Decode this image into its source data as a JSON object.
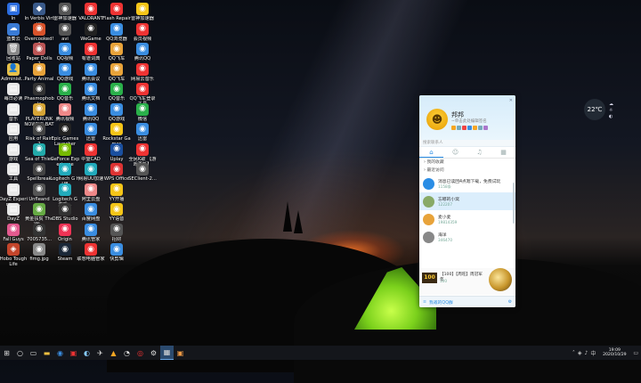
{
  "desktop_icons": [
    {
      "label": "In",
      "color": "#2b6de0",
      "glyph": "▣"
    },
    {
      "label": "蓝奏云",
      "color": "#3a7bd5",
      "glyph": "☁"
    },
    {
      "label": "回收站",
      "color": "#888",
      "glyph": "🗑"
    },
    {
      "label": "Administ...",
      "color": "#e6c14a",
      "glyph": "👤"
    },
    {
      "label": "每日必读",
      "color": "#e7e7e7",
      "glyph": "▤"
    },
    {
      "label": "音乐",
      "color": "#e7e7e7",
      "glyph": "▤"
    },
    {
      "label": "应用",
      "color": "#e7e7e7",
      "glyph": "▤"
    },
    {
      "label": "游戏",
      "color": "#e7e7e7",
      "glyph": "▤"
    },
    {
      "label": "工具",
      "color": "#e7e7e7",
      "glyph": "▤"
    },
    {
      "label": "DayZ Experimen...",
      "color": "#e7e7e7",
      "glyph": "▤"
    },
    {
      "label": "DayZ",
      "color": "#e7e7e7",
      "glyph": "▤"
    },
    {
      "label": "Fall Guys",
      "color": "#e35a8f",
      "glyph": "◉"
    },
    {
      "label": "Hobo Tough Life",
      "color": "#c4452b",
      "glyph": "◈"
    },
    {
      "label": "In Verbis Virtus",
      "color": "#3a5a8a",
      "glyph": "◆"
    },
    {
      "label": "Overcooked! 2",
      "color": "#d9532b",
      "glyph": "◉"
    },
    {
      "label": "Paper Dolls 2",
      "color": "#b55",
      "glyph": "◉"
    },
    {
      "label": "Party Animals",
      "color": "#e8a33a",
      "glyph": "◉"
    },
    {
      "label": "Phasmophobia",
      "color": "#333",
      "glyph": "◉"
    },
    {
      "label": "PLAYERUNKNOWN'S BATTLEGROUNDS",
      "color": "#d6a536",
      "glyph": "◉"
    },
    {
      "label": "Risk of Rain 2",
      "color": "#444",
      "glyph": "◉"
    },
    {
      "label": "Sea of Thieves",
      "color": "#2aa",
      "glyph": "◉"
    },
    {
      "label": "Spellbreak",
      "color": "#444",
      "glyph": "◉"
    },
    {
      "label": "Unfleand",
      "color": "#555",
      "glyph": "◉"
    },
    {
      "label": "黄金扶贫 The Wi...",
      "color": "#6a4",
      "glyph": "◉"
    },
    {
      "label": "7005735...",
      "color": "#333",
      "glyph": "◉"
    },
    {
      "label": "fimg.jpg",
      "color": "#888",
      "glyph": "◉"
    },
    {
      "label": "雷神加速器",
      "color": "#555",
      "glyph": "◉"
    },
    {
      "label": "avi",
      "color": "#555",
      "glyph": "◉"
    },
    {
      "label": "QQ视频",
      "color": "#3a8de0",
      "glyph": "◉"
    },
    {
      "label": "QQ游戏",
      "color": "#3a8de0",
      "glyph": "◉"
    },
    {
      "label": "QQ音乐",
      "color": "#2ab04a",
      "glyph": "◉"
    },
    {
      "label": "腾讯视频",
      "color": "#e88",
      "glyph": "◉"
    },
    {
      "label": "Epic Games Launcher",
      "color": "#222",
      "glyph": "◉"
    },
    {
      "label": "GeForce Experience",
      "color": "#76b900",
      "glyph": "◉"
    },
    {
      "label": "Logitech G HUB",
      "color": "#2ab",
      "glyph": "◉"
    },
    {
      "label": "Logitech G 游戏...",
      "color": "#2ab",
      "glyph": "◉"
    },
    {
      "label": "OBS Studio",
      "color": "#333",
      "glyph": "◉"
    },
    {
      "label": "Origin",
      "color": "#e35",
      "glyph": "◉"
    },
    {
      "label": "Steam",
      "color": "#1b2838",
      "glyph": "◉"
    },
    {
      "label": "VALORANT",
      "color": "#e33",
      "glyph": "◉"
    },
    {
      "label": "WeGame",
      "color": "#222",
      "glyph": "◉"
    },
    {
      "label": "有道词典",
      "color": "#e33",
      "glyph": "◉"
    },
    {
      "label": "腾讯会议",
      "color": "#3a8de0",
      "glyph": "◉"
    },
    {
      "label": "腾讯文档",
      "color": "#3a8de0",
      "glyph": "◉"
    },
    {
      "label": "腾讯QQ",
      "color": "#3a8de0",
      "glyph": "◉"
    },
    {
      "label": "迅雷",
      "color": "#3a8de0",
      "glyph": "◉"
    },
    {
      "label": "中望CAD",
      "color": "#e33",
      "glyph": "◉"
    },
    {
      "label": "网易UU加速",
      "color": "#2ab",
      "glyph": "◉"
    },
    {
      "label": "阿里云盘",
      "color": "#e88",
      "glyph": "◉"
    },
    {
      "label": "百度网盘",
      "color": "#3a8de0",
      "glyph": "◉"
    },
    {
      "label": "腾讯管家",
      "color": "#3a8de0",
      "glyph": "◉"
    },
    {
      "label": "联想电脑管家",
      "color": "#e33",
      "glyph": "◉"
    },
    {
      "label": "Flash Repair",
      "color": "#e33",
      "glyph": "◉"
    },
    {
      "label": "QQ浏览器",
      "color": "#3a8de0",
      "glyph": "◉"
    },
    {
      "label": "QQ飞车",
      "color": "#e8a33a",
      "glyph": "◉"
    },
    {
      "label": "QQ飞车",
      "color": "#e8a33a",
      "glyph": "◉"
    },
    {
      "label": "QQ音乐",
      "color": "#2ab04a",
      "glyph": "◉"
    },
    {
      "label": "QQ游戏",
      "color": "#3a8de0",
      "glyph": "◉"
    },
    {
      "label": "Rockstar Games",
      "color": "#f5c518",
      "glyph": "◉"
    },
    {
      "label": "Uplay",
      "color": "#1a4f9f",
      "glyph": "◉"
    },
    {
      "label": "WPS Office",
      "color": "#d33",
      "glyph": "◉"
    },
    {
      "label": "YY开播",
      "color": "#f5c518",
      "glyph": "◉"
    },
    {
      "label": "YY语音",
      "color": "#f5c518",
      "glyph": "◉"
    },
    {
      "label": "招财",
      "color": "#555",
      "glyph": "◉"
    },
    {
      "label": "快剪辑",
      "color": "#3a8de0",
      "glyph": "◉"
    },
    {
      "label": "雷神加速器",
      "color": "#f5c518",
      "glyph": "◉"
    },
    {
      "label": "会员视频",
      "color": "#e33",
      "glyph": "◉"
    },
    {
      "label": "腾讯QQ",
      "color": "#3a8de0",
      "glyph": "◉"
    },
    {
      "label": "网易云音乐",
      "color": "#e33",
      "glyph": "◉"
    },
    {
      "label": "QQ飞车登录工具",
      "color": "#e33",
      "glyph": "◉"
    },
    {
      "label": "微信",
      "color": "#2ab04a",
      "glyph": "◉"
    },
    {
      "label": "迅雷",
      "color": "#3a8de0",
      "glyph": "◉"
    },
    {
      "label": "全民K歌 【游戏更新】",
      "color": "#e33",
      "glyph": "◉"
    },
    {
      "label": "SEClient-2...",
      "color": "#555",
      "glyph": "◉"
    }
  ],
  "qq_panel": {
    "nickname": "邦邦",
    "signature": "~单击此处编辑签名",
    "search_placeholder": "搜索联系人",
    "top_controls": "✕",
    "group_favorites": "› 我的收藏",
    "group_recent": "› 最近访问",
    "contacts": [
      {
        "name": "消息已读回4点嗯下载，免费试玩",
        "status": "1158条",
        "color": "#2a8de5"
      },
      {
        "name": "忘嘟的小窝",
        "status": "122207",
        "color": "#8a6"
      },
      {
        "name": "麦小麦",
        "status": "19814359",
        "color": "#e8a33a"
      },
      {
        "name": "海洋",
        "status": "346470",
        "color": "#888"
      }
    ],
    "promo_badge": "100",
    "promo_text": "【100】【周旺】周冠军年",
    "promo_sub": "100",
    "footer_text": "我邀的QQ群"
  },
  "weather": {
    "temp": "22℃"
  },
  "taskbar": {
    "time": "19:09",
    "date": "2020/10/29",
    "lang": "中"
  }
}
